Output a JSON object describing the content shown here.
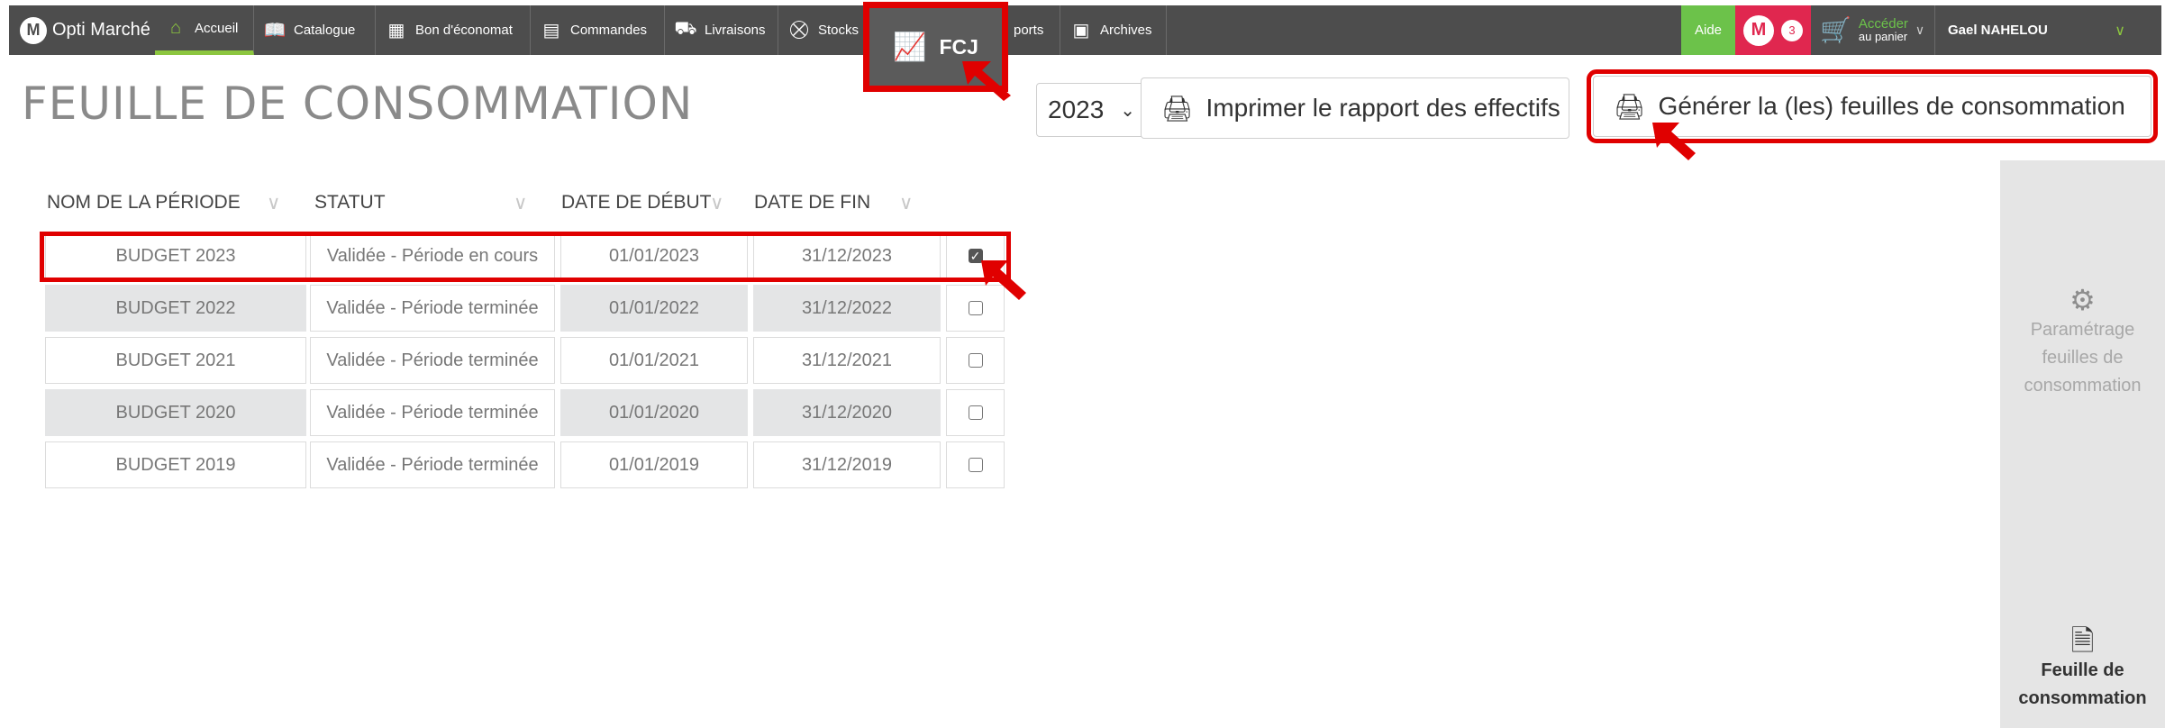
{
  "nav": {
    "brand": "Opti Marché",
    "items": [
      {
        "label": "Accueil",
        "icon": "home-icon"
      },
      {
        "label": "Catalogue",
        "icon": "book-icon"
      },
      {
        "label": "Bon d'économat",
        "icon": "cabinet-icon"
      },
      {
        "label": "Commandes",
        "icon": "clipboard-icon"
      },
      {
        "label": "Livraisons",
        "icon": "truck-icon"
      },
      {
        "label": "Stocks",
        "icon": "forklift-icon"
      },
      {
        "label": "ports",
        "icon": ""
      },
      {
        "label": "Archives",
        "icon": "archive-icon"
      }
    ],
    "fcj_label": "FCJ",
    "help_label": "Aide",
    "notif_logo": "M",
    "notif_count": "3",
    "cart_line1": "Accéder",
    "cart_line2": "au panier",
    "user_name": "Gael NAHELOU"
  },
  "page": {
    "title": "FEUILLE DE CONSOMMATION",
    "year_selected": "2023",
    "print_button": "Imprimer le rapport des effectifs",
    "generate_button": "Générer la (les) feuilles de consommation"
  },
  "table": {
    "headers": [
      "NOM DE LA PÉRIODE",
      "STATUT",
      "DATE DE DÉBUT",
      "DATE DE FIN"
    ],
    "rows": [
      {
        "name": "BUDGET 2023",
        "status": "Validée - Période en cours",
        "start": "01/01/2023",
        "end": "31/12/2023",
        "checked": true
      },
      {
        "name": "BUDGET 2022",
        "status": "Validée - Période terminée",
        "start": "01/01/2022",
        "end": "31/12/2022",
        "checked": false
      },
      {
        "name": "BUDGET 2021",
        "status": "Validée - Période terminée",
        "start": "01/01/2021",
        "end": "31/12/2021",
        "checked": false
      },
      {
        "name": "BUDGET 2020",
        "status": "Validée - Période terminée",
        "start": "01/01/2020",
        "end": "31/12/2020",
        "checked": false
      },
      {
        "name": "BUDGET 2019",
        "status": "Validée - Période terminée",
        "start": "01/01/2019",
        "end": "31/12/2019",
        "checked": false
      }
    ]
  },
  "side": {
    "settings_line1": "Paramétrage",
    "settings_line2": "feuilles de",
    "settings_line3": "consommation",
    "feuille_line1": "Feuille de",
    "feuille_line2": "consommation"
  },
  "colors": {
    "accent_green": "#8cc63f",
    "alert_red": "#e00000",
    "notif_pink": "#e0274f",
    "navbar": "#4d4d4d"
  }
}
